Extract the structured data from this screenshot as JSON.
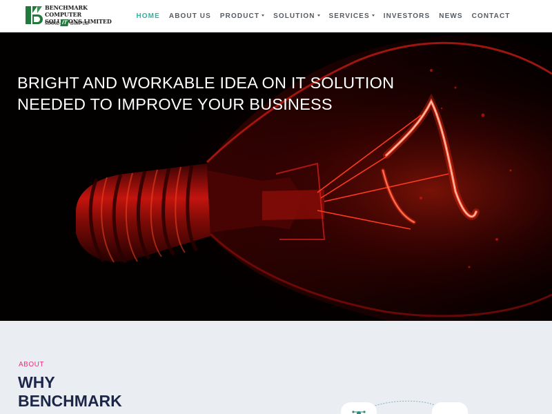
{
  "brand": {
    "name_line1": "BENCHMARK COMPUTER",
    "name_line2": "SOLUTIONS LIMITED",
    "tagline_pre": "MAKE",
    "tagline_it": "IT",
    "tagline_post": "SIMPLE",
    "colors": {
      "logo_green": "#1f7a3c",
      "nav_active": "#2bb5a0",
      "nav_text": "#555b61"
    }
  },
  "nav": {
    "items": [
      {
        "label": "HOME",
        "active": true,
        "dropdown": false
      },
      {
        "label": "ABOUT US",
        "active": false,
        "dropdown": false
      },
      {
        "label": "PRODUCT",
        "active": false,
        "dropdown": true
      },
      {
        "label": "SOLUTION",
        "active": false,
        "dropdown": true
      },
      {
        "label": "SERVICES",
        "active": false,
        "dropdown": true
      },
      {
        "label": "INVESTORS",
        "active": false,
        "dropdown": false
      },
      {
        "label": "NEWS",
        "active": false,
        "dropdown": false
      },
      {
        "label": "CONTACT",
        "active": false,
        "dropdown": false
      }
    ]
  },
  "hero": {
    "line1": "BRIGHT AND WORKABLE IDEA ON IT SOLUTION",
    "line2": "NEEDED TO IMPROVE YOUR BUSINESS",
    "image": "red-light-bulb",
    "colors": {
      "background": "#030000",
      "glow": "#e0201a"
    }
  },
  "about": {
    "eyebrow": "ABOUT",
    "heading_line1": "WHY",
    "heading_line2": "BENCHMARK",
    "colors": {
      "eyebrow": "#e0357a",
      "heading": "#1c2648",
      "background": "#eaedf1"
    }
  }
}
